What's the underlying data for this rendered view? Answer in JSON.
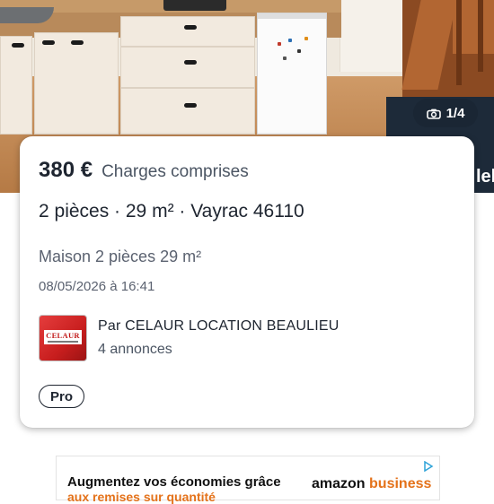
{
  "photo": {
    "counter": "1/4",
    "peek_text": "lel"
  },
  "listing": {
    "price": "380 €",
    "charges": "Charges comprises",
    "details": "2 pièces · 29 m² · Vayrac 46110",
    "title": "Maison 2 pièces 29 m²",
    "date": "08/05/2026 à 16:41",
    "agency": {
      "logo_text": "CELAUR",
      "name": "Par CELAUR LOCATION BEAULIEU",
      "count": "4 annonces"
    },
    "badge": "Pro"
  },
  "ad": {
    "line1": "Augmentez vos économies grâce",
    "line2": "aux remises sur quantité",
    "brand_a": "amazon",
    "brand_b": "business",
    "accent": "#e4721a"
  },
  "icons": {
    "camera": "camera-icon",
    "adchoices": "adchoices-icon"
  },
  "colors": {
    "text_primary": "#1e2530",
    "text_secondary": "#4b5563",
    "counter_bg": "#1a2634",
    "logo_red": "#c81e1e"
  }
}
